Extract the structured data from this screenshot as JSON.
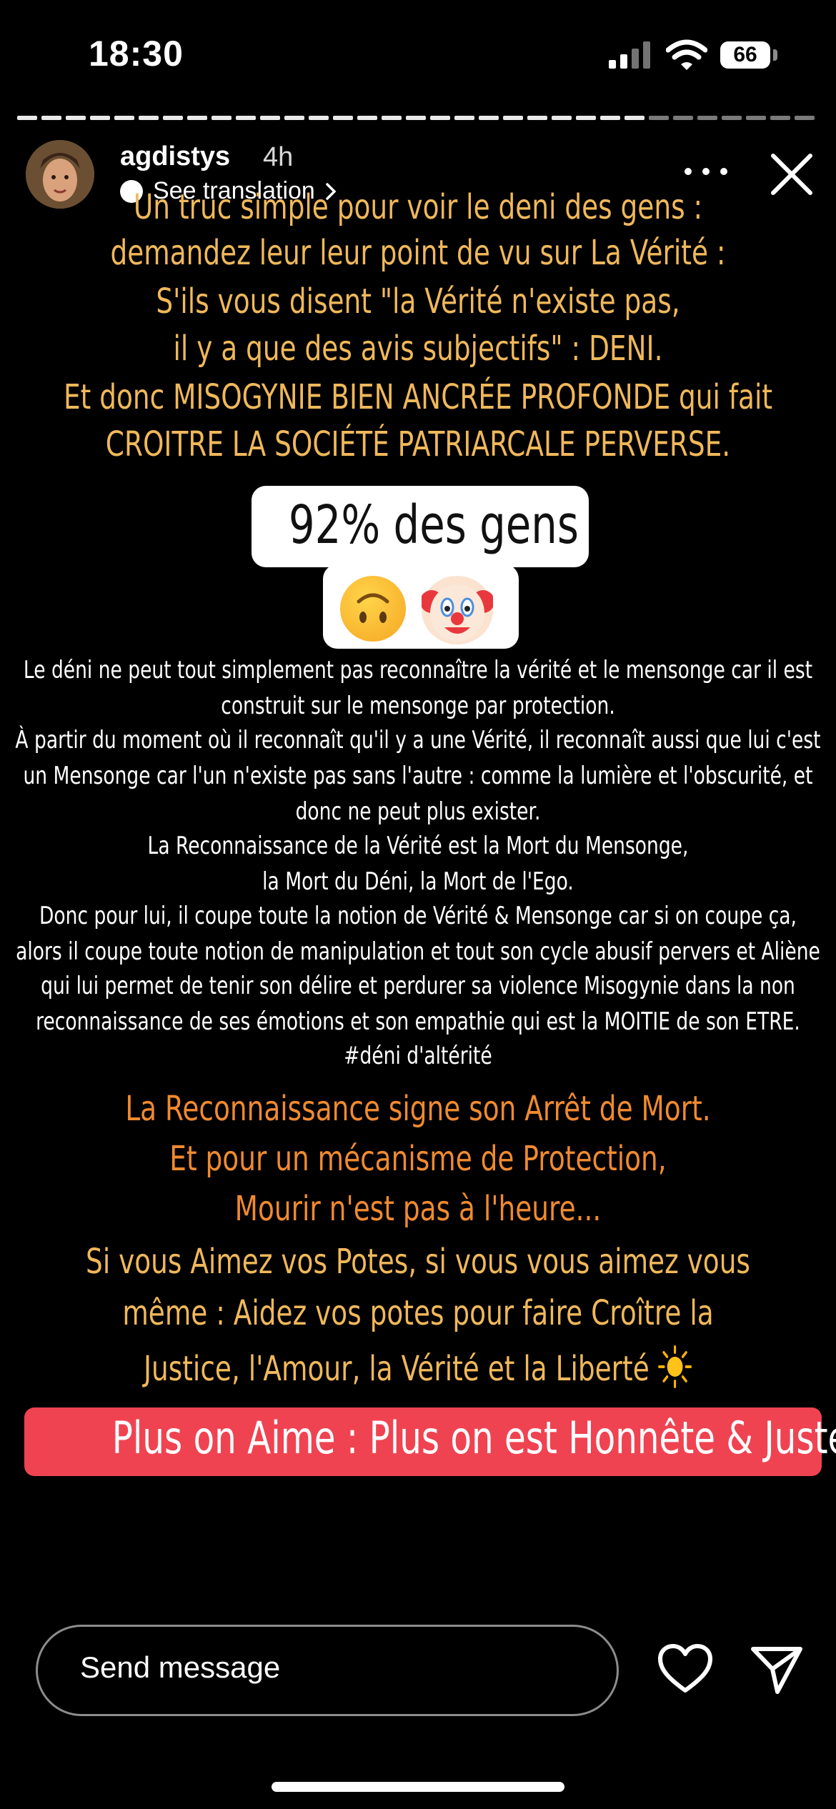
{
  "status_bar": {
    "time": "18:30",
    "battery": "66",
    "icons": [
      "cellular-signal-icon",
      "wifi-icon",
      "battery-icon"
    ]
  },
  "story": {
    "progress_segments": 33,
    "username": "agdistys",
    "time_ago": "4h",
    "see_translation": "See translation",
    "block1": [
      "Un truc simple pour voir le deni des gens :",
      "demandez leur leur  point de vu sur La Vérité :",
      "S'ils vous disent \"la Vérité n'existe pas,",
      "il y a que des avis subjectifs\" : DENI.",
      "Et donc MISOGYNIE BIEN ANCRÉE PROFONDE qui fait",
      "CROITRE LA SOCIÉTÉ PATRIARCALE PERVERSE."
    ],
    "sticker_text": "92% des gens",
    "sticker_emojis": [
      "upside-down-face-emoji",
      "clown-face-emoji"
    ],
    "block2": [
      "Le déni ne peut tout simplement pas reconnaître la vérité et le mensonge car il est",
      "construit sur le mensonge par protection.",
      "À partir du moment où il reconnaît qu'il y a une Vérité, il reconnaît aussi que lui c'est",
      "un Mensonge car l'un n'existe pas sans l'autre : comme la lumière et l'obscurité, et",
      "donc ne peut plus exister.",
      "La Reconnaissance de la Vérité est la Mort du Mensonge,",
      "la Mort du Déni, la Mort de l'Ego.",
      "Donc pour lui, il coupe toute la notion de Vérité & Mensonge car si on coupe ça,",
      "alors il coupe toute notion de manipulation et tout son cycle abusif pervers et Aliène",
      "qui lui permet de tenir son délire et perdurer sa violence Misogynie dans la non",
      "reconnaissance de ses émotions et son empathie qui est la MOITIE de son ETRE.",
      "#déni d'altérité"
    ],
    "block3": [
      "La Reconnaissance signe son Arrêt de Mort.",
      "Et pour un mécanisme de Protection,",
      "Mourir n'est pas à l'heure..."
    ],
    "block4": [
      "Si vous Aimez vos Potes, si vous vous aimez vous",
      "même : Aidez vos potes pour faire Croître la",
      "Justice, l'Amour, la Vérité et la Liberté"
    ],
    "block4_emoji": "sun-emoji",
    "banner": "Plus on Aime : Plus on est Honnête & Juste."
  },
  "footer": {
    "message_placeholder": "Send message"
  },
  "colors": {
    "background": "#000000",
    "yellow_text": "#f0b85a",
    "orange_text": "#f08a30",
    "banner": "#f04351"
  }
}
